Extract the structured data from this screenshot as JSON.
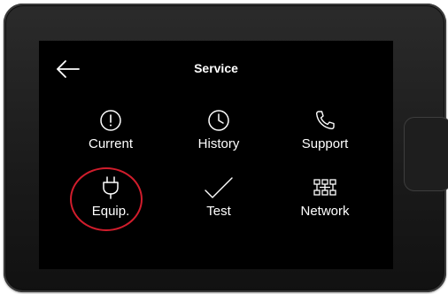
{
  "header": {
    "title": "Service"
  },
  "tiles": [
    {
      "label": "Current",
      "icon": "alert-circle-icon"
    },
    {
      "label": "History",
      "icon": "clock-icon"
    },
    {
      "label": "Support",
      "icon": "phone-icon"
    },
    {
      "label": "Equip.",
      "icon": "plug-icon"
    },
    {
      "label": "Test",
      "icon": "check-icon"
    },
    {
      "label": "Network",
      "icon": "network-icon"
    }
  ],
  "colors": {
    "screen": "#000000",
    "text": "#ffffff",
    "bezel": "#1e1e1e",
    "highlight": "#d11d2c"
  }
}
